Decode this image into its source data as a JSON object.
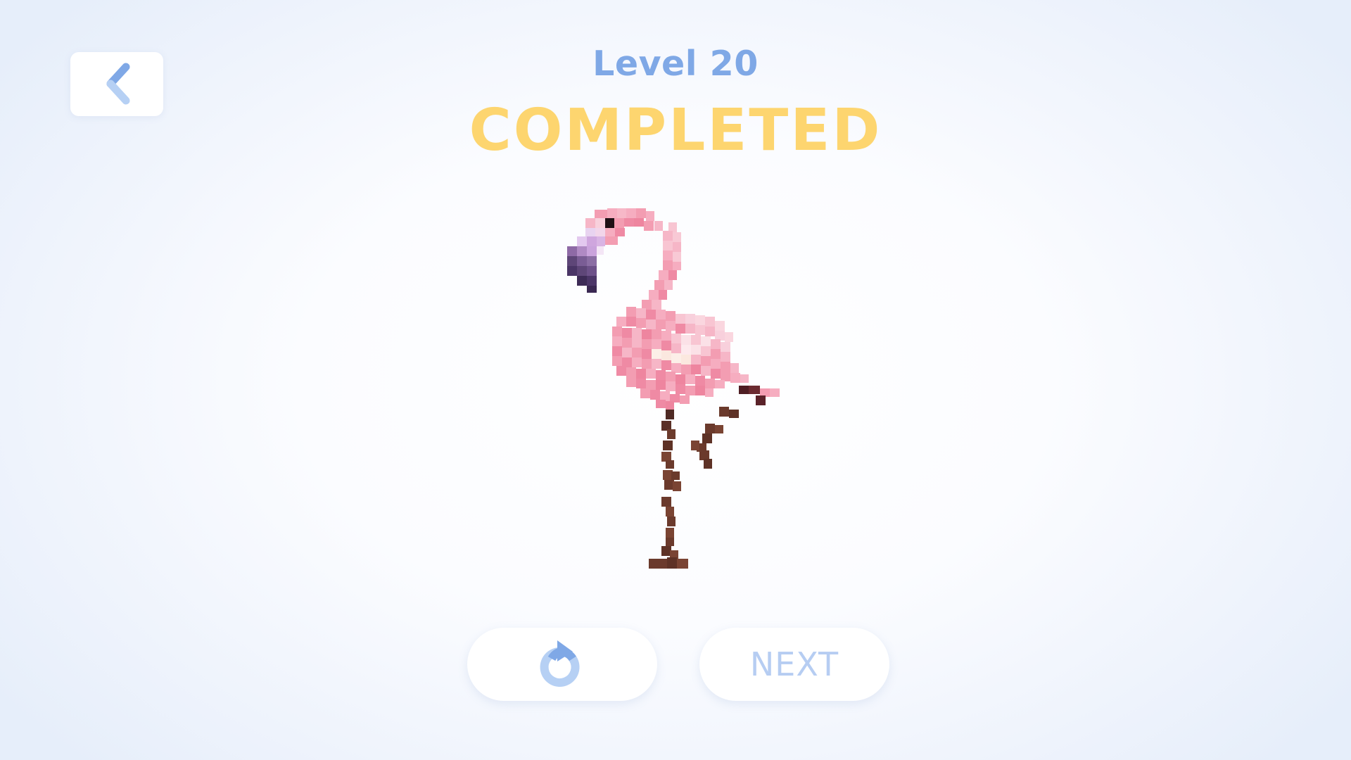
{
  "header": {
    "level_label": "Level 20",
    "status_label": "COMPLETED"
  },
  "icons": {
    "back": "chevron-left-icon",
    "replay": "replay-icon"
  },
  "buttons": {
    "next_label": "NEXT"
  },
  "artwork": {
    "subject": "flamingo",
    "style": "pixel-art"
  },
  "colors": {
    "level_text": "#7fa8e6",
    "completed_text": "#fdd56f",
    "next_text": "#b6cdf2",
    "icon_blue": "#7fa8e6",
    "icon_blue_light": "#b6d0f4"
  }
}
